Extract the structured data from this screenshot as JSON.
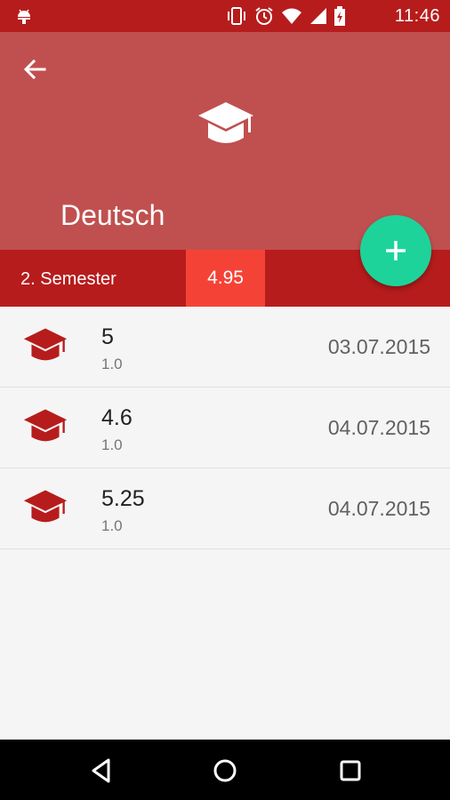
{
  "status_bar": {
    "time": "11:46",
    "icons": [
      "android-icon",
      "vibrate-icon",
      "alarm-icon",
      "wifi-icon",
      "signal-icon",
      "battery-icon"
    ]
  },
  "header": {
    "title": "Deutsch",
    "color": "#c0504f",
    "icon": "graduation-cap-icon"
  },
  "semester": {
    "label": "2. Semester",
    "average": "4.95",
    "bar_color": "#b71c1c",
    "average_color": "#f44336"
  },
  "fab": {
    "icon": "plus-icon",
    "color": "#1dd39a"
  },
  "grades": [
    {
      "value": "5",
      "weight": "1.0",
      "date": "03.07.2015"
    },
    {
      "value": "4.6",
      "weight": "1.0",
      "date": "04.07.2015"
    },
    {
      "value": "5.25",
      "weight": "1.0",
      "date": "04.07.2015"
    }
  ],
  "nav": {
    "icons": [
      "back-triangle-icon",
      "home-circle-icon",
      "recents-square-icon"
    ]
  }
}
